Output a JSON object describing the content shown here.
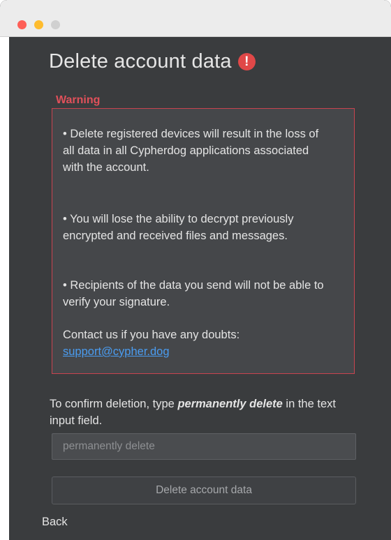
{
  "window": {
    "controls": [
      "close",
      "minimize",
      "maximize"
    ],
    "colors": {
      "close": "#fe5f57",
      "minimize": "#febc2e",
      "maximize": "#d0d0d0",
      "background": "#3a3c3e",
      "warning": "#c9444f",
      "link": "#4a9cf0"
    }
  },
  "header": {
    "title": "Delete account data",
    "alert_icon": "!"
  },
  "warning": {
    "label": "Warning",
    "items": [
      "• Delete registered devices will result in the loss of all data in all Cypherdog applications associated with the account.",
      "• You will lose the ability to decrypt previously encrypted and received files and messages.",
      "• Recipients of the data you send will not be able to verify your signature."
    ],
    "contact_text": "Contact us if you have any doubts:",
    "contact_email": "support@cypher.dog"
  },
  "confirm": {
    "prefix": "To confirm deletion, type ",
    "keyword": "permanently delete",
    "suffix": " in the text input field.",
    "input_placeholder": "permanently delete",
    "input_value": ""
  },
  "actions": {
    "delete_label": "Delete account data",
    "back_label": "Back"
  }
}
